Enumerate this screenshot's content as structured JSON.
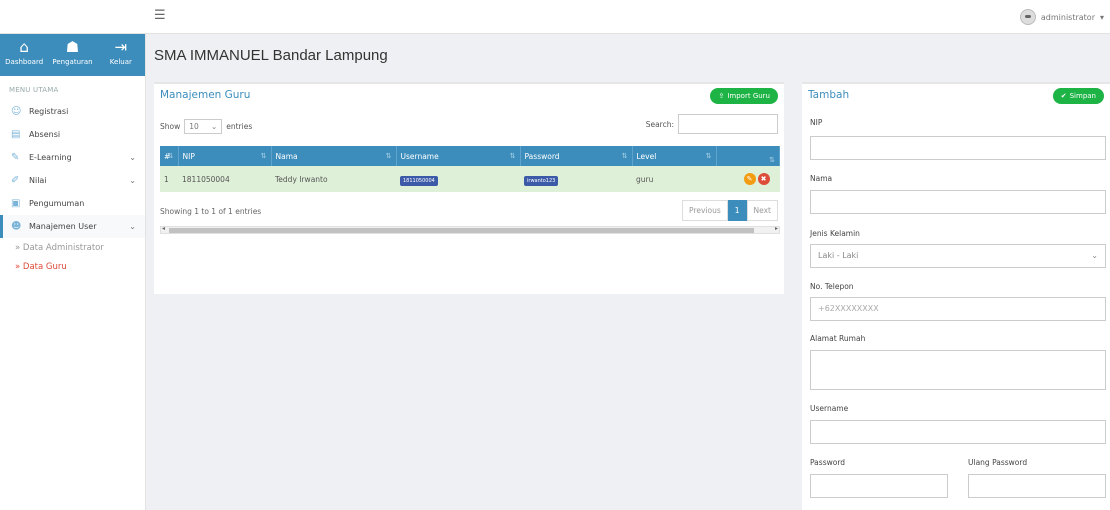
{
  "topbar": {
    "menu_icon": "hamburger-icon",
    "user_name": "administrator",
    "user_caret": "▾"
  },
  "sidebar": {
    "top_buttons": [
      {
        "label": "Dashboard",
        "icon": "home-icon"
      },
      {
        "label": "Pengaturan",
        "icon": "users-gear-icon"
      },
      {
        "label": "Keluar",
        "icon": "sign-out-icon"
      }
    ],
    "menu_title": "MENU UTAMA",
    "items": [
      {
        "label": "Registrasi",
        "icon": "registration-icon",
        "expandable": false
      },
      {
        "label": "Absensi",
        "icon": "attendance-icon",
        "expandable": false
      },
      {
        "label": "E-Learning",
        "icon": "elearning-icon",
        "expandable": true
      },
      {
        "label": "Nilai",
        "icon": "grades-icon",
        "expandable": true
      },
      {
        "label": "Pengumuman",
        "icon": "announcement-icon",
        "expandable": false
      },
      {
        "label": "Manajemen User",
        "icon": "user-management-icon",
        "expandable": true
      }
    ],
    "subitems": [
      {
        "label": "» Data Administrator",
        "active": false
      },
      {
        "label": "» Data Guru",
        "active": true
      }
    ]
  },
  "main": {
    "page_title": "SMA IMMANUEL Bandar Lampung",
    "left_panel": {
      "title": "Manajemen Guru",
      "import_button": "Import Guru",
      "show_label": "Show",
      "show_value": "10",
      "entries_label": "entries",
      "search_label": "Search:",
      "columns": [
        "#",
        "NIP",
        "Nama",
        "Username",
        "Password",
        "Level",
        ""
      ],
      "rows": [
        {
          "no": "1",
          "nip": "1811050004",
          "nama": "Teddy Irwanto",
          "username": "1811050004",
          "password": "irwanto123",
          "level": "guru"
        }
      ],
      "info": "Showing 1 to 1 of 1 entries",
      "pager": {
        "prev": "Previous",
        "current": "1",
        "next": "Next"
      }
    },
    "right_panel": {
      "title": "Tambah",
      "save_button": "Simpan",
      "fields": {
        "nip_label": "NIP",
        "nama_label": "Nama",
        "gender_label": "Jenis Kelamin",
        "gender_value": "Laki - Laki",
        "phone_label": "No. Telepon",
        "phone_placeholder": "+62XXXXXXXX",
        "address_label": "Alamat Rumah",
        "username_label": "Username",
        "password_label": "Password",
        "repeat_password_label": "Ulang Password"
      }
    }
  },
  "colors": {
    "primary": "#3c8dbc",
    "success": "#1db345",
    "danger": "#dd4b39",
    "warning": "#f39c12",
    "row_success": "#dff0d8"
  }
}
